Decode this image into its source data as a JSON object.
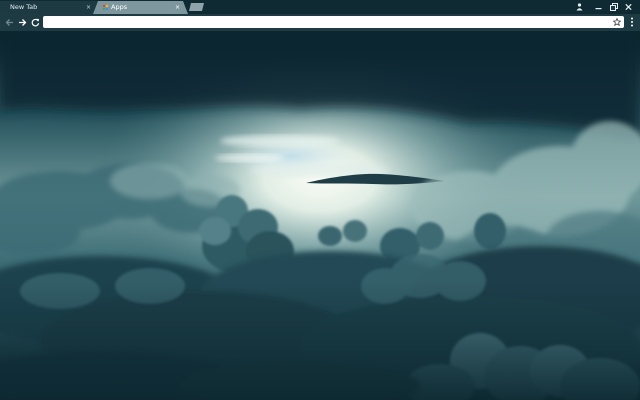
{
  "browser": {
    "tabs": [
      {
        "label": "New Tab",
        "active": false
      },
      {
        "label": "Apps",
        "active": true
      }
    ],
    "close_glyph": "×",
    "window_controls": {
      "profile_icon": "person-icon",
      "minimize_icon": "minimize-icon",
      "restore_icon": "restore-icon",
      "close_icon": "close-icon"
    }
  },
  "toolbar": {
    "back_icon": "back-arrow-icon",
    "forward_icon": "forward-arrow-icon",
    "reload_icon": "reload-icon",
    "omnibox_value": "",
    "bookmark_icon": "star-icon",
    "menu_icon": "kebab-menu-icon"
  },
  "theme": {
    "tabstrip": "#102a33",
    "toolbar": "#1e3a43",
    "active_tab": "#7e979e",
    "sky_top": "#0b2731",
    "light": "#f4f9f4",
    "cloud_dark": "#17363f"
  },
  "background": {
    "subject": "cloud-sky-wallpaper"
  }
}
